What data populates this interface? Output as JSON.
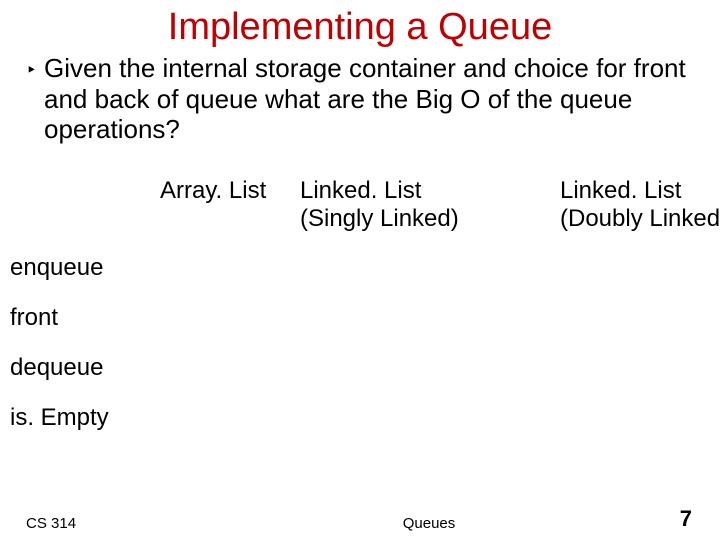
{
  "title": "Implementing a Queue",
  "bullet_marker": "‣",
  "bullet_text": "Given the internal storage container and choice for front and back of queue what are the Big O of the queue operations?",
  "columns": {
    "array": "Array. List",
    "singly_line1": "Linked. List",
    "singly_line2": "(Singly Linked)",
    "doubly_line1": "Linked. List",
    "doubly_line2": "(Doubly Linked)"
  },
  "rows": {
    "r1": "enqueue",
    "r2": "front",
    "r3": "dequeue",
    "r4": "is. Empty"
  },
  "footer": {
    "course": "CS 314",
    "topic": "Queues",
    "page": "7"
  },
  "chart_data": {
    "type": "table",
    "title": "Implementing a Queue",
    "columns": [
      "Array. List",
      "Linked. List (Singly Linked)",
      "Linked. List (Doubly Linked)"
    ],
    "rows": [
      "enqueue",
      "front",
      "dequeue",
      "is. Empty"
    ],
    "values": [
      [
        "",
        "",
        ""
      ],
      [
        "",
        "",
        ""
      ],
      [
        "",
        "",
        ""
      ],
      [
        "",
        "",
        ""
      ]
    ]
  }
}
